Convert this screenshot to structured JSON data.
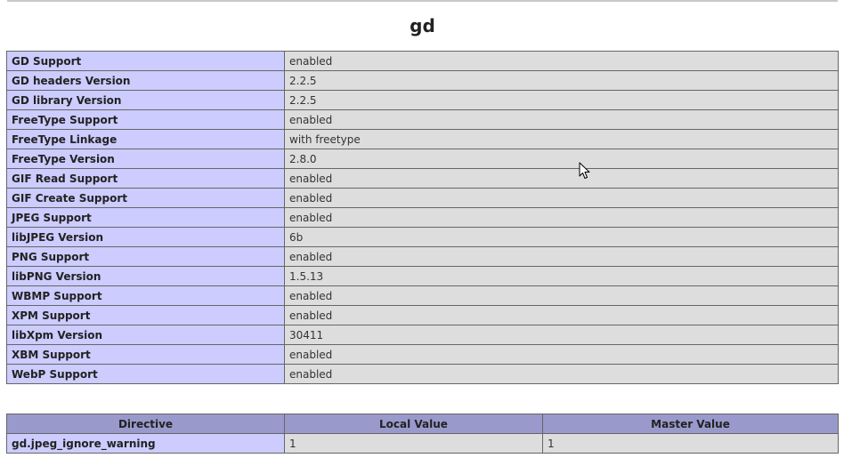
{
  "module": {
    "title": "gd"
  },
  "gd_table": {
    "rows": [
      {
        "name": "GD Support",
        "value": "enabled"
      },
      {
        "name": "GD headers Version",
        "value": "2.2.5"
      },
      {
        "name": "GD library Version",
        "value": "2.2.5"
      },
      {
        "name": "FreeType Support",
        "value": "enabled"
      },
      {
        "name": "FreeType Linkage",
        "value": "with freetype"
      },
      {
        "name": "FreeType Version",
        "value": "2.8.0"
      },
      {
        "name": "GIF Read Support",
        "value": "enabled"
      },
      {
        "name": "GIF Create Support",
        "value": "enabled"
      },
      {
        "name": "JPEG Support",
        "value": "enabled"
      },
      {
        "name": "libJPEG Version",
        "value": "6b"
      },
      {
        "name": "PNG Support",
        "value": "enabled"
      },
      {
        "name": "libPNG Version",
        "value": "1.5.13"
      },
      {
        "name": "WBMP Support",
        "value": "enabled"
      },
      {
        "name": "XPM Support",
        "value": "enabled"
      },
      {
        "name": "libXpm Version",
        "value": "30411"
      },
      {
        "name": "XBM Support",
        "value": "enabled"
      },
      {
        "name": "WebP Support",
        "value": "enabled"
      }
    ]
  },
  "directive_table": {
    "headers": [
      "Directive",
      "Local Value",
      "Master Value"
    ],
    "rows": [
      {
        "directive": "gd.jpeg_ignore_warning",
        "local": "1",
        "master": "1"
      }
    ]
  },
  "colors": {
    "name_cell": "#ccccff",
    "value_cell": "#dddddd",
    "header_cell": "#9999cc"
  },
  "icons": {
    "cursor": "mouse-pointer-icon"
  }
}
